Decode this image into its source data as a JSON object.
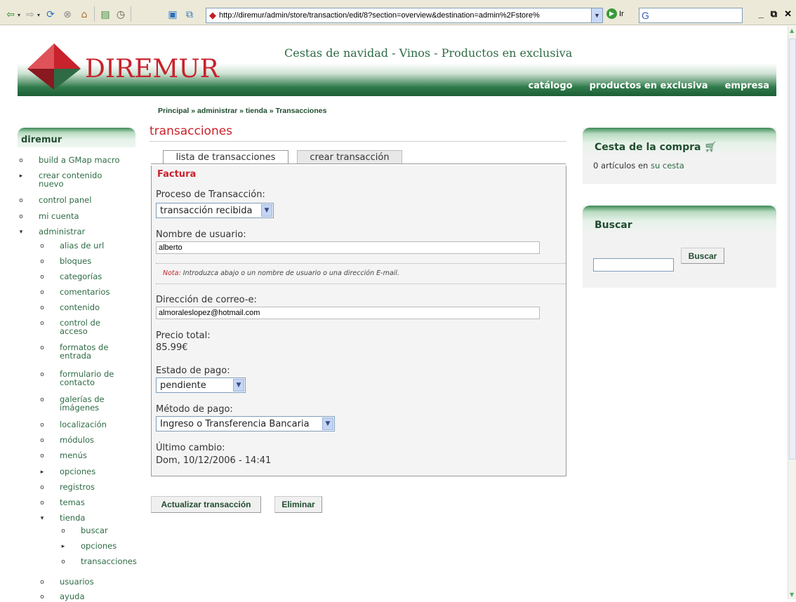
{
  "browser": {
    "url": "http://diremur/admin/store/transaction/edit/8?section=overview&destination=admin%2Fstore%",
    "go_label": "Ir",
    "search_logo": "G"
  },
  "header": {
    "logo_text": "DIREMUR",
    "slogan": "Cestas de navidad - Vinos - Productos en exclusiva",
    "nav": [
      "catálogo",
      "productos en exclusiva",
      "empresa"
    ]
  },
  "breadcrumb": "Principal » administrar » tienda » Transacciones",
  "sidebar": {
    "title": "diremur",
    "items": [
      {
        "label": "build a GMap macro"
      },
      {
        "label": "crear contenido\nnuevo"
      },
      {
        "label": "control panel"
      },
      {
        "label": "mi cuenta"
      },
      {
        "label": "administrar"
      },
      {
        "label": "alias de url"
      },
      {
        "label": "bloques"
      },
      {
        "label": "categorías"
      },
      {
        "label": "comentarios"
      },
      {
        "label": "contenido"
      },
      {
        "label": "control de\nacceso"
      },
      {
        "label": "formatos de\nentrada"
      },
      {
        "label": "formulario de\ncontacto"
      },
      {
        "label": "galerías de\nimágenes"
      },
      {
        "label": "localización"
      },
      {
        "label": "módulos"
      },
      {
        "label": "menús"
      },
      {
        "label": "opciones"
      },
      {
        "label": "registros"
      },
      {
        "label": "temas"
      },
      {
        "label": "tienda"
      },
      {
        "label": "buscar"
      },
      {
        "label": "opciones"
      },
      {
        "label": "transacciones"
      },
      {
        "label": "usuarios"
      },
      {
        "label": "ayuda"
      }
    ]
  },
  "main": {
    "title": "transacciones",
    "tabs": [
      "lista de transacciones",
      "crear transacción"
    ],
    "legend": "Factura",
    "process_label": "Proceso de Transacción:",
    "process_value": "transacción recibida",
    "username_label": "Nombre de usuario:",
    "username_value": "alberto",
    "note_label": "Nota:",
    "note_text": "Introduzca abajo o un nombre de usuario o una dirección E-mail.",
    "email_label": "Dirección de correo-e:",
    "email_value": "almoraleslopez@hotmail.com",
    "total_label": "Precio total:",
    "total_value": "85.99€",
    "payment_status_label": "Estado de pago:",
    "payment_status_value": "pendiente",
    "payment_method_label": "Método de pago:",
    "payment_method_value": "Ingreso o Transferencia Bancaria",
    "last_change_label": "Último cambio:",
    "last_change_value": "Dom, 10/12/2006 - 14:41",
    "update_button": "Actualizar transacción",
    "delete_button": "Eliminar"
  },
  "cart": {
    "title": "Cesta de la compra",
    "text": "0 artículos en",
    "link": "su cesta"
  },
  "search": {
    "title": "Buscar",
    "button": "Buscar"
  },
  "colors": {
    "brand_red": "#c8222c",
    "brand_green": "#2e6b44"
  }
}
